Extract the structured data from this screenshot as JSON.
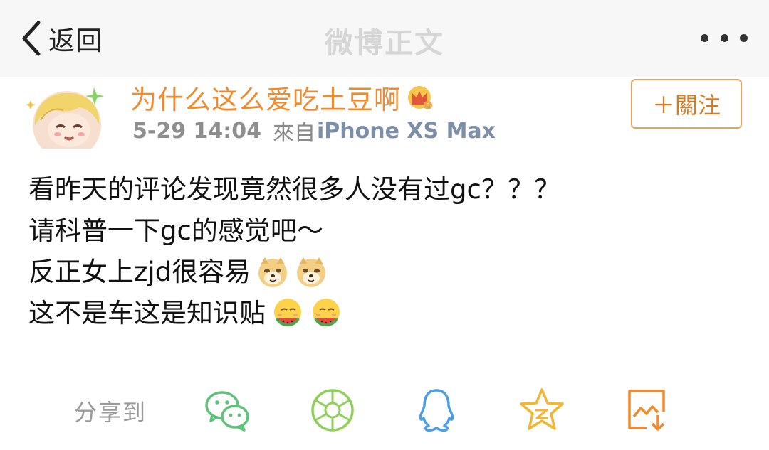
{
  "navbar": {
    "back_label": "返回",
    "title": "微博正文",
    "back_icon": "chevron-left-icon",
    "more_icon": "more-dots-icon"
  },
  "post": {
    "username": "为什么这么爱吃土豆啊",
    "vip_badge_icon": "vip-crown-icon",
    "time": "5-29 14:04",
    "from_label": "來自",
    "device": "iPhone XS Max",
    "follow_label": "＋關注",
    "lines": [
      {
        "text": "看昨天的评论发现竟然很多人没有过gc？？？",
        "emojis": []
      },
      {
        "text": "请科普一下gc的感觉吧～",
        "emojis": []
      },
      {
        "text": "反正女上zjd很容易",
        "emojis": [
          "doge-emoji",
          "doge-emoji"
        ]
      },
      {
        "text": "这不是车这是知识贴",
        "emojis": [
          "watermelon-eating-emoji",
          "watermelon-eating-emoji"
        ]
      }
    ]
  },
  "share": {
    "label": "分享到",
    "targets": [
      "wechat-icon",
      "moments-icon",
      "qq-icon",
      "qzone-icon",
      "save-image-icon"
    ]
  },
  "colors": {
    "username": "#f08a2c",
    "follow_border": "#e4a262",
    "device": "#7d8fa8",
    "share_green": "#5ec27a",
    "share_blue": "#4a9ee6",
    "share_gold": "#f2b630",
    "share_orange": "#f08a2c"
  }
}
